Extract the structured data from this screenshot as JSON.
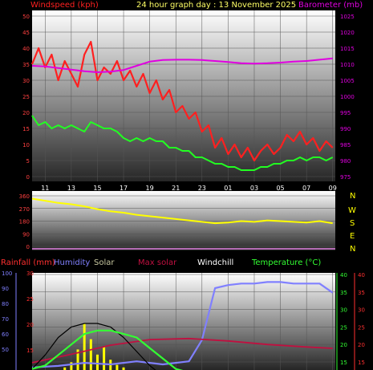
{
  "colors": {
    "background": "#000000",
    "windspeed": "#ff2020",
    "gust_title": "#ff2020",
    "wind_avg": "#22ff22",
    "barometer": "#e000e0",
    "direction": "#ffff00",
    "compass": "#ffff00",
    "header": "#ffff66",
    "rain": "#ff3030",
    "humidity": "#8080ff",
    "solar": "#c8c8a0",
    "maxsolar": "#c01040",
    "windchill": "#ffffff",
    "temperature": "#33ff33",
    "temp_axis": "#ff3030",
    "axis_red": "#ff4040"
  },
  "top_panel": {
    "title_left": "Windspeed (kph)",
    "title_center": "24 hour graph day : 13 November 2025",
    "title_right": "Barometer (mb)",
    "x_ticks": [
      "11",
      "13",
      "15",
      "17",
      "19",
      "21",
      "23",
      "01",
      "03",
      "05",
      "07",
      "09"
    ],
    "y_left_ticks": [
      "50",
      "45",
      "40",
      "35",
      "30",
      "25",
      "20",
      "15",
      "10",
      "5",
      "0"
    ],
    "y_right_ticks": [
      "1025",
      "1020",
      "1015",
      "1010",
      "1005",
      "1000",
      "995",
      "990",
      "985",
      "980",
      "975"
    ]
  },
  "dir_panel": {
    "y_ticks": [
      "360",
      "270",
      "180",
      "90",
      "0"
    ],
    "compass": [
      "N",
      "W",
      "S",
      "E",
      "N"
    ]
  },
  "bottom_panel": {
    "legend": {
      "rainfall": "Rainfall (mm)",
      "humidity": "Humidity",
      "solar": "Solar",
      "maxsolar": "Max solar",
      "windchill": "Windchill",
      "temperature": "Temperature (°C)"
    },
    "hum_ticks": [
      "100",
      "90",
      "80",
      "70",
      "60",
      "50"
    ],
    "rain_ticks": [
      "30",
      "25",
      "20",
      "15"
    ],
    "temp_ticks_left": [
      "40",
      "35",
      "30",
      "25",
      "20",
      "15"
    ],
    "temp_ticks_right": [
      "40",
      "35",
      "30",
      "25",
      "20",
      "15"
    ]
  },
  "chart_data": [
    {
      "type": "line",
      "title": "24 hour graph day : 13 November 2025",
      "ylabel": "Windspeed (kph)",
      "y2label": "Barometer (mb)",
      "xlim": [
        10,
        33.2
      ],
      "ylim": [
        0,
        50
      ],
      "y2lim": [
        975,
        1025
      ],
      "series": [
        {
          "name": "Windspeed (kph)",
          "axis": "left",
          "x": [
            10,
            10.5,
            11,
            11.5,
            12,
            12.5,
            13,
            13.5,
            14,
            14.5,
            15,
            15.5,
            16,
            16.5,
            17,
            17.5,
            18,
            18.5,
            19,
            19.5,
            20,
            20.5,
            21,
            21.5,
            22,
            22.5,
            23,
            23.5,
            24,
            24.5,
            25,
            25.5,
            26,
            26.5,
            27,
            27.5,
            28,
            28.5,
            29,
            29.5,
            30,
            30.5,
            31,
            31.5,
            32,
            32.5,
            33
          ],
          "y": [
            35,
            40,
            34,
            38,
            30,
            36,
            32,
            28,
            38,
            42,
            30,
            34,
            32,
            36,
            30,
            33,
            28,
            32,
            26,
            30,
            24,
            27,
            20,
            22,
            18,
            20,
            14,
            16,
            9,
            12,
            7,
            10,
            6,
            9,
            5,
            8,
            10,
            7,
            9,
            13,
            11,
            14,
            10,
            12,
            8,
            11,
            9
          ]
        },
        {
          "name": "Wind avg (kph)",
          "axis": "left",
          "x": [
            10,
            10.5,
            11,
            11.5,
            12,
            12.5,
            13,
            13.5,
            14,
            14.5,
            15,
            15.5,
            16,
            16.5,
            17,
            17.5,
            18,
            18.5,
            19,
            19.5,
            20,
            20.5,
            21,
            21.5,
            22,
            22.5,
            23,
            23.5,
            24,
            24.5,
            25,
            25.5,
            26,
            26.5,
            27,
            27.5,
            28,
            28.5,
            29,
            29.5,
            30,
            30.5,
            31,
            31.5,
            32,
            32.5,
            33
          ],
          "y": [
            19,
            16,
            17,
            15,
            16,
            15,
            16,
            15,
            14,
            17,
            16,
            15,
            15,
            14,
            12,
            11,
            12,
            11,
            12,
            11,
            11,
            9,
            9,
            8,
            8,
            6,
            6,
            5,
            4,
            4,
            3,
            3,
            2,
            2,
            2,
            3,
            3,
            4,
            4,
            5,
            5,
            6,
            5,
            6,
            6,
            5,
            6
          ]
        },
        {
          "name": "Barometer (mb)",
          "axis": "right",
          "x": [
            10,
            11,
            12,
            13,
            14,
            15,
            16,
            17,
            18,
            19,
            20,
            21,
            22,
            23,
            24,
            25,
            26,
            27,
            28,
            29,
            30,
            31,
            32,
            33
          ],
          "y": [
            1009.5,
            1009.3,
            1008.8,
            1008.3,
            1007.8,
            1007.5,
            1007.7,
            1008.2,
            1009.5,
            1010.8,
            1011.3,
            1011.4,
            1011.4,
            1011.3,
            1011.0,
            1010.7,
            1010.3,
            1010.2,
            1010.3,
            1010.5,
            1010.8,
            1011.0,
            1011.4,
            1011.8
          ]
        }
      ]
    },
    {
      "type": "line",
      "ylabel": "",
      "xlim": [
        10,
        33.2
      ],
      "ylim": [
        0,
        360
      ],
      "series": [
        {
          "name": "Wind direction",
          "x": [
            10,
            11,
            12,
            13,
            14,
            15,
            16,
            17,
            18,
            19,
            20,
            21,
            22,
            23,
            24,
            25,
            26,
            27,
            28,
            29,
            30,
            31,
            32,
            33
          ],
          "y": [
            340,
            325,
            310,
            300,
            285,
            265,
            250,
            240,
            225,
            215,
            205,
            195,
            185,
            175,
            165,
            170,
            180,
            175,
            185,
            180,
            175,
            170,
            180,
            165
          ]
        }
      ]
    },
    {
      "type": "line",
      "xlim": [
        10,
        33.2
      ],
      "series": [
        {
          "name": "Humidity",
          "axis": "humidity",
          "x": [
            10,
            12,
            14,
            16,
            18,
            20,
            22,
            23,
            24,
            25,
            26,
            27,
            28,
            29,
            30,
            31,
            32,
            33
          ],
          "y": [
            38,
            39,
            41,
            40,
            42,
            40,
            42,
            56,
            90,
            92,
            93,
            93,
            94,
            94,
            93,
            93,
            93,
            87
          ]
        },
        {
          "name": "Solar",
          "axis": "solar",
          "x": [
            12,
            12.5,
            13,
            13.5,
            14,
            14.5,
            15,
            15.5,
            16,
            16.5,
            17,
            18
          ],
          "y": [
            0,
            10,
            30,
            80,
            180,
            120,
            60,
            90,
            40,
            20,
            10,
            0
          ]
        },
        {
          "name": "Max solar",
          "axis": "temperature",
          "x": [
            10,
            13,
            16,
            19,
            22,
            25,
            28,
            31,
            33
          ],
          "y": [
            14.8,
            17.2,
            19.8,
            21.4,
            21.7,
            21.0,
            20.0,
            19.3,
            18.9
          ]
        },
        {
          "name": "Windchill",
          "axis": "temperature",
          "x": [
            10,
            11,
            12,
            13,
            14,
            15,
            16,
            17,
            18,
            19,
            20
          ],
          "y": [
            13,
            17,
            22,
            25,
            26,
            26,
            25,
            22,
            18,
            14,
            11
          ]
        },
        {
          "name": "Temperature (°C)",
          "axis": "temperature",
          "x": [
            10,
            11,
            12,
            13,
            14,
            15,
            16,
            17,
            18,
            19,
            20,
            21,
            22,
            23,
            24,
            25,
            26,
            27,
            28,
            29,
            30,
            31,
            32,
            33
          ],
          "y": [
            13,
            14,
            17,
            20,
            23,
            24,
            24,
            23,
            22,
            19,
            16,
            13,
            12,
            11,
            10,
            10,
            10,
            10,
            10,
            10,
            10,
            10,
            11,
            12
          ]
        }
      ]
    }
  ]
}
